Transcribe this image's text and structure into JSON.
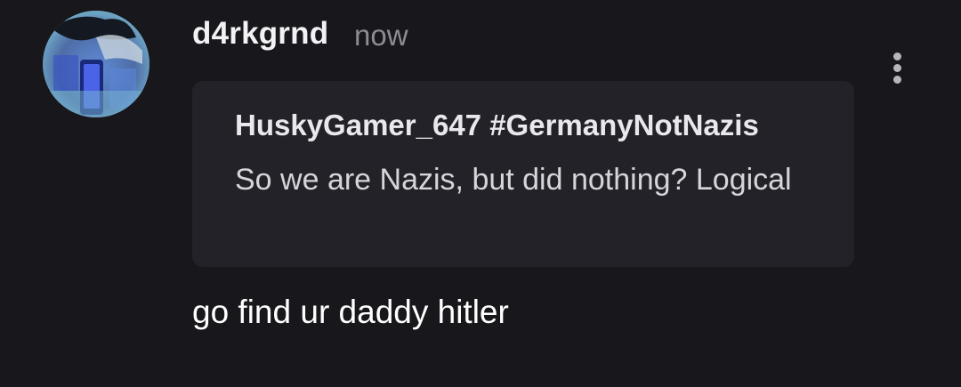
{
  "comment": {
    "username": "d4rkgrnd",
    "timestamp": "now",
    "avatar_icon": "user-avatar",
    "more_icon": "more-vertical-icon",
    "quote": {
      "author": "HuskyGamer_647 #GermanyNotNazis",
      "text": "So we are Nazis, but did nothing? Logical"
    },
    "body": "go find ur daddy hitler"
  },
  "colors": {
    "background": "#18171c",
    "quote_background": "#232228",
    "muted_text": "#8d8c94"
  }
}
